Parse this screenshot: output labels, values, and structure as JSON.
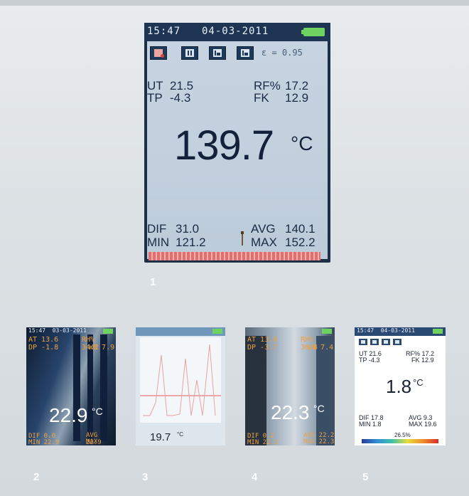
{
  "main": {
    "status": {
      "time": "15:47",
      "date": "04-03-2011"
    },
    "emissivity": "ε = 0.95",
    "readings": {
      "ut_label": "UT",
      "ut_value": "21.5",
      "rf_label": "RF%",
      "rf_value": "17.2",
      "tp_label": "TP",
      "tp_value": "-4.3",
      "fk_label": "FK",
      "fk_value": "12.9",
      "temperature": "139.7",
      "unit": "°C",
      "dif_label": "DIF",
      "dif_value": "31.0",
      "avg_label": "AVG",
      "avg_value": "140.1",
      "min_label": "MIN",
      "min_value": "121.2",
      "max_label": "MAX",
      "max_value": "152.2"
    },
    "toolbar_icons": [
      "record-icon",
      "pause-icon",
      "trend-low-icon",
      "trend-high-icon"
    ],
    "colors": {
      "panel": "#c4d1de",
      "status": "#1d3552",
      "battery": "#6ed261",
      "scale": "#e46e6e"
    }
  },
  "labels": {
    "one": "1",
    "two": "2",
    "three": "3",
    "four": "4",
    "five": "5"
  },
  "thumb2": {
    "time": "15:47",
    "date": "03-03-2011",
    "at": "AT 13.6",
    "rh": "RH% 34.2",
    "dp": "DP -1.8",
    "wb": "WB 7.9",
    "temperature": "22.9",
    "unit": "°C",
    "dif": "DIF 0.0",
    "avg": "AVG 22.9",
    "min": "MIN 22.9",
    "max": "MAX 22.9"
  },
  "thumb3": {
    "value": "19.7",
    "unit": "°C"
  },
  "thumb4": {
    "at": "AT 13.0",
    "rh": "RH% 36.4",
    "dp": "DP -3.7",
    "wb": "WB 7.4",
    "temperature": "22.3",
    "unit": "°C",
    "dif": "DIF 0.2",
    "avg": "AVG 22.2",
    "min": "MIN 22.1",
    "max": "MAX 22.3"
  },
  "thumb5": {
    "time": "15:47",
    "date": "04-03-2011",
    "ut": "UT 21.6",
    "rf": "RF% 17.2",
    "tp": "TP -4.3",
    "fk": "FK 12.9",
    "temperature": "1.8",
    "unit": "°C",
    "dif": "DIF 17.8",
    "avg": "AVG 9.3",
    "min": "MIN 1.8",
    "max": "MAX 19.6",
    "scale_value": "26.5%"
  }
}
